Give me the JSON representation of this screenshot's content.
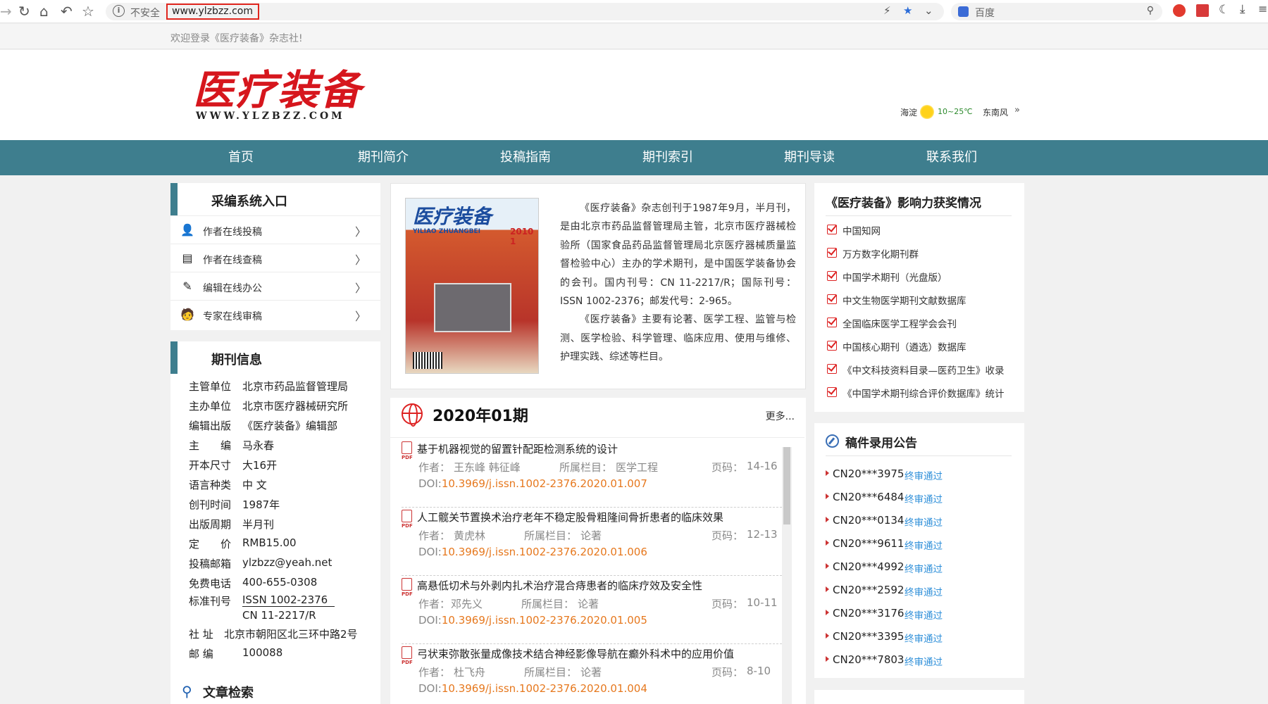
{
  "browser": {
    "insecure_label": "不安全",
    "url": "www.ylzbzz.com",
    "search_placeholder": "百度"
  },
  "site": {
    "welcome": "欢迎登录《医疗装备》杂志社!",
    "logo_text": "医疗装备",
    "logo_url": "WWW.YLZBZZ.COM",
    "weather": {
      "city": "海淀",
      "temp": "10~25℃",
      "wind": "东南风",
      "more": "»"
    }
  },
  "nav": [
    "首页",
    "期刊简介",
    "投稿指南",
    "期刊索引",
    "期刊导读",
    "联系我们"
  ],
  "system_entry": {
    "title": "采编系统入口",
    "items": [
      {
        "label": "作者在线投稿",
        "icon": "author-submit-icon"
      },
      {
        "label": "作者在线查稿",
        "icon": "document-check-icon"
      },
      {
        "label": "编辑在线办公",
        "icon": "editor-pen-icon"
      },
      {
        "label": "专家在线审稿",
        "icon": "expert-review-icon"
      }
    ],
    "arrow": "〉"
  },
  "journal_info": {
    "title": "期刊信息",
    "rows": [
      {
        "k": "主管单位",
        "v": "北京市药品监督管理局"
      },
      {
        "k": "主办单位",
        "v": "北京市医疗器械研究所"
      },
      {
        "k": "编辑出版",
        "v": "《医疗装备》编辑部"
      },
      {
        "k": "主　　编",
        "v": "马永春"
      },
      {
        "k": "开本尺寸",
        "v": "大16开"
      },
      {
        "k": "语言种类",
        "v": "中 文"
      },
      {
        "k": "创刊时间",
        "v": "1987年"
      },
      {
        "k": "出版周期",
        "v": "半月刊"
      },
      {
        "k": "定　　价",
        "v": "RMB15.00"
      },
      {
        "k": "投稿邮箱",
        "v": "ylzbzz@yeah.net"
      },
      {
        "k": "免费电话",
        "v": "400-655-0308"
      },
      {
        "k": "标准刊号",
        "v": "ISSN 1002-2376"
      },
      {
        "k": "",
        "v": "CN 11-2217/R"
      },
      {
        "k": "社 址",
        "v": "北京市朝阳区北三环中路2号"
      },
      {
        "k": "邮 编",
        "v": "100088"
      }
    ],
    "search_title": "文章检索"
  },
  "intro": {
    "cover": {
      "title": "医疗装备",
      "subtitle": "YILIAO ZHUANGBEI",
      "year": "2010 1"
    },
    "p1": "《医疗装备》杂志创刊于1987年9月，半月刊，是由北京市药品监督管理局主管，北京市医疗器械检验所（国家食品药品监督管理局北京医疗器械质量监督检验中心）主办的学术期刊，是中国医学装备协会的会刊。国内刊号：CN 11-2217/R；国际刊号：ISSN 1002-2376；邮发代号：2-965。",
    "p2": "《医疗装备》主要有论著、医学工程、监管与检测、医学检验、科学管理、临床应用、使用与维修、护理实践、综述等栏目。"
  },
  "issue": {
    "title": "2020年01期",
    "more": "更多...",
    "articles": [
      {
        "title": "基于机器视觉的留置针配距检测系统的设计",
        "author_label": "作者：",
        "authors": "王东峰 韩征峰",
        "column_label": "所属栏目：",
        "column": "医学工程",
        "page_label": "页码：",
        "pages": "14-16",
        "doi_label": "DOI:",
        "doi": "10.3969/j.issn.1002-2376.2020.01.007"
      },
      {
        "title": "人工髋关节置换术治疗老年不稳定股骨粗隆间骨折患者的临床效果",
        "author_label": "作者：",
        "authors": "黄虎林",
        "column_label": "所属栏目：",
        "column": "论著",
        "page_label": "页码：",
        "pages": "12-13",
        "doi_label": "DOI:",
        "doi": "10.3969/j.issn.1002-2376.2020.01.006"
      },
      {
        "title": "高悬低切术与外剥内扎术治疗混合痔患者的临床疗效及安全性",
        "author_label": "作者：",
        "authors": "邓先义",
        "column_label": "所属栏目：",
        "column": "论著",
        "page_label": "页码：",
        "pages": "10-11",
        "doi_label": "DOI:",
        "doi": "10.3969/j.issn.1002-2376.2020.01.005"
      },
      {
        "title": "弓状束弥散张量成像技术结合神经影像导航在癫外科术中的应用价值",
        "author_label": "作者：",
        "authors": "杜飞舟",
        "column_label": "所属栏目：",
        "column": "论著",
        "page_label": "页码：",
        "pages": "8-10",
        "doi_label": "DOI:",
        "doi": "10.3969/j.issn.1002-2376.2020.01.004"
      }
    ]
  },
  "awards": {
    "title": "《医疗装备》影响力获奖情况",
    "items": [
      "中国知网",
      "万方数字化期刊群",
      "中国学术期刊（光盘版）",
      "中文生物医学期刊文献数据库",
      "全国临床医学工程学会会刊",
      "中国核心期刊（遴选）数据库",
      "《中文科技资料目录—医药卫生》收录",
      "《中国学术期刊综合评价数据库》统计"
    ]
  },
  "notices": {
    "title": "稿件录用公告",
    "status": "终审通过",
    "codes": [
      "CN20***3975",
      "CN20***6484",
      "CN20***0134",
      "CN20***9611",
      "CN20***4992",
      "CN20***2592",
      "CN20***3176",
      "CN20***3395",
      "CN20***7803"
    ]
  },
  "colors": {
    "nav": "#3e7e8e",
    "logo": "#d6161d",
    "doi": "#e6781e",
    "status": "#2e8fd9"
  }
}
